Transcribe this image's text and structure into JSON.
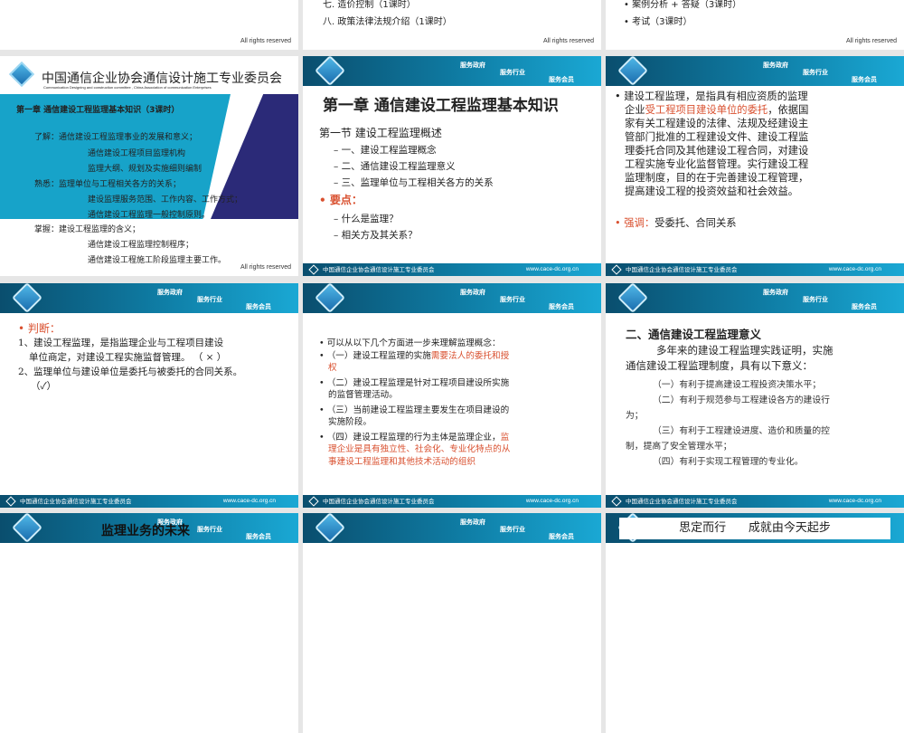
{
  "slides": {
    "top": {
      "left_footer": "All rights reserved",
      "mid_lines": [
        "七. 造价控制（1课时）",
        "八. 政策法律法规介绍（1课时）"
      ],
      "mid_footer": "All rights reserved",
      "right_lines": [
        "案例分析 + 答疑（3课时）",
        "考试（3课时）"
      ],
      "right_footer": "All rights reserved"
    },
    "cover": {
      "org_name": "中国通信企业协会通信设计施工专业委员会",
      "org_en": "Communication Designing and construction committee ,  China Association of communication Enterprises",
      "title": "第一章  通信建设工程监理基本知识（3课时）",
      "lines": [
        "了解：通信建设工程监理事业的发展和意义；",
        "通信建设工程项目监理机构",
        "监理大纲、规划及实施细则编制",
        "熟悉：监理单位与工程相关各方的关系；",
        "建设监理服务范围、工作内容、工作方式；",
        "通信建设工程监理一般控制原则。",
        "掌握：建设工程监理的含义；",
        "通信建设工程监理控制程序；",
        "通信建设工程施工阶段监理主要工作。"
      ],
      "footer": "All rights reserved"
    },
    "header": {
      "slogans": [
        "服务政府",
        "服务行业",
        "服务会员"
      ]
    },
    "footer": {
      "org": "中国通信企业协会通信设计施工专业委员会",
      "url": "www.cace-dc.org.cn"
    },
    "ch1": {
      "title": "第一章  通信建设工程监理基本知识",
      "section": "第一节 建设工程监理概述",
      "items": [
        "– 一、建设工程监理概念",
        "– 二、通信建设工程监理意义",
        "– 三、监理单位与工程相关各方的关系"
      ],
      "key_label": "要点：",
      "keys": [
        "– 什么是监理？",
        "– 相关方及其关系？"
      ]
    },
    "def": {
      "p1": "建设工程监理，是指具有相应资质的监理",
      "p2a": "企业",
      "p2red": "受工程项目建设单位的委托",
      "p2b": "，依据国",
      "rest": [
        "家有关工程建设的法律、法规及经建设主",
        "管部门批准的工程建设文件、建设工程监",
        "理委托合同及其他建设工程合同，对建设",
        "工程实施专业化监督管理。实行建设工程",
        "监理制度，目的在于完善建设工程管理，",
        "提高建设工程的投资效益和社会效益。"
      ],
      "emph_label": "强调：",
      "emph": "受委托、合同关系"
    },
    "judge": {
      "label": "判断：",
      "lines": [
        "1、建设工程监理，是指监理企业与工程项目建设",
        "单位商定，对建设工程实施监督管理。  （ × ）",
        "2、监理单位与建设单位是委托与被委托的合同关系。",
        "（✓）"
      ]
    },
    "understand": {
      "intro": "可以从以下几个方面进一步来理解监理概念：",
      "i1a": "（一）建设工程监理的实施",
      "i1red": "需要法人的委托和授",
      "i1red2": "权",
      "i2": [
        "（二）建设工程监理是针对工程项目建设所实施",
        "的监督管理活动。"
      ],
      "i3": [
        "（三）当前建设工程监理主要发生在项目建设的",
        "实施阶段。"
      ],
      "i4a": "（四）建设工程监理的行为主体是监理企业，",
      "i4red": "监",
      "i4red2": [
        "理企业是具有独立性、社会化、专业化特点的从",
        "事建设工程监理和其他技术活动的组织"
      ]
    },
    "meaning": {
      "title": "二、通信建设工程监理意义",
      "lines": [
        "多年来的建设工程监理实践证明，实施",
        "通信建设工程监理制度，具有以下意义：",
        "（一）有利于提高建设工程投资决策水平；",
        "（二）有利于规范参与工程建设各方的建设行",
        "为；",
        "（三）有利于工程建设进度、造价和质量的控",
        "制，提高了安全管理水平；",
        "（四）有利于实现工程管理的专业化。"
      ]
    },
    "future": {
      "title": "监理业务的未来"
    },
    "motto": {
      "text": "思定而行      成就由今天起步"
    }
  }
}
